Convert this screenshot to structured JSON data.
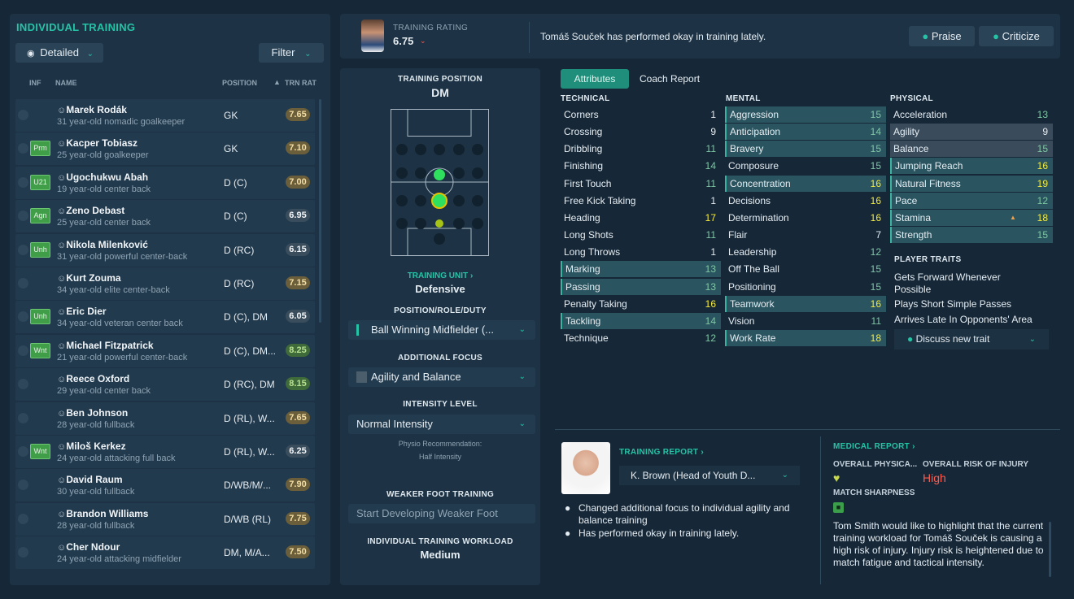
{
  "left": {
    "title": "INDIVIDUAL TRAINING",
    "detailed": "Detailed",
    "filter": "Filter",
    "cols": {
      "inf": "INF",
      "name": "NAME",
      "position": "POSITION",
      "trn": "TRN RAT"
    },
    "players": [
      {
        "name": "Marek Rodák",
        "desc": "31 year-old nomadic goalkeeper",
        "pos": "GK",
        "rat": "7.65",
        "badge": "",
        "ratStyle": "gold"
      },
      {
        "name": "Kacper Tobiasz",
        "desc": "25 year-old goalkeeper",
        "pos": "GK",
        "rat": "7.10",
        "badge": "Prm",
        "ratStyle": "gold"
      },
      {
        "name": "Ugochukwu Abah",
        "desc": "19 year-old center back",
        "pos": "D (C)",
        "rat": "7.00",
        "badge": "U21",
        "ratStyle": "gold"
      },
      {
        "name": "Zeno Debast",
        "desc": "25 year-old center back",
        "pos": "D (C)",
        "rat": "6.95",
        "badge": "Agn",
        "ratStyle": "dark"
      },
      {
        "name": "Nikola Milenković",
        "desc": "31 year-old powerful center-back",
        "pos": "D (RC)",
        "rat": "6.15",
        "badge": "Unh",
        "ratStyle": "dark"
      },
      {
        "name": "Kurt Zouma",
        "desc": "34 year-old elite center-back",
        "pos": "D (RC)",
        "rat": "7.15",
        "badge": "",
        "ratStyle": "gold"
      },
      {
        "name": "Eric Dier",
        "desc": "34 year-old veteran center back",
        "pos": "D (C), DM",
        "rat": "6.05",
        "badge": "Unh",
        "ratStyle": "dark"
      },
      {
        "name": "Michael Fitzpatrick",
        "desc": "21 year-old powerful center-back",
        "pos": "D (C), DM...",
        "rat": "8.25",
        "badge": "Wnt",
        "ratStyle": "green"
      },
      {
        "name": "Reece Oxford",
        "desc": "29 year-old center back",
        "pos": "D (RC), DM",
        "rat": "8.15",
        "badge": "",
        "ratStyle": "green"
      },
      {
        "name": "Ben Johnson",
        "desc": "28 year-old fullback",
        "pos": "D (RL), W...",
        "rat": "7.65",
        "badge": "",
        "ratStyle": "gold"
      },
      {
        "name": "Miloš Kerkez",
        "desc": "24 year-old attacking full back",
        "pos": "D (RL), W...",
        "rat": "6.25",
        "badge": "Wnt",
        "ratStyle": "dark"
      },
      {
        "name": "David Raum",
        "desc": "30 year-old fullback",
        "pos": "D/WB/M/...",
        "rat": "7.90",
        "badge": "",
        "ratStyle": "gold"
      },
      {
        "name": "Brandon Williams",
        "desc": "28 year-old fullback",
        "pos": "D/WB (RL)",
        "rat": "7.75",
        "badge": "",
        "ratStyle": "gold"
      },
      {
        "name": "Cher Ndour",
        "desc": "24 year-old attacking midfielder",
        "pos": "DM, M/A...",
        "rat": "7.50",
        "badge": "",
        "ratStyle": "gold"
      }
    ]
  },
  "top": {
    "label": "TRAINING RATING",
    "rating": "6.75",
    "message": "Tomáš Souček has performed okay in training lately.",
    "praise": "Praise",
    "criticize": "Criticize"
  },
  "mid": {
    "posLabel": "TRAINING POSITION",
    "pos": "DM",
    "unitLabel": "TRAINING UNIT",
    "unit": "Defensive",
    "prdLabel": "POSITION/ROLE/DUTY",
    "prd": "Ball Winning Midfielder (...",
    "focusLabel": "ADDITIONAL FOCUS",
    "focus": "Agility and Balance",
    "intLabel": "INTENSITY LEVEL",
    "intensity": "Normal Intensity",
    "physio1": "Physio Recommendation:",
    "physio2": "Half Intensity",
    "weakLabel": "WEAKER FOOT TRAINING",
    "weak": "Start Developing Weaker Foot",
    "wlLabel": "INDIVIDUAL TRAINING WORKLOAD",
    "workload": "Medium"
  },
  "tabs": {
    "attributes": "Attributes",
    "coach": "Coach Report"
  },
  "technical": {
    "title": "TECHNICAL",
    "items": [
      [
        "Corners",
        "1"
      ],
      [
        "Crossing",
        "9"
      ],
      [
        "Dribbling",
        "11"
      ],
      [
        "Finishing",
        "14"
      ],
      [
        "First Touch",
        "11"
      ],
      [
        "Free Kick Taking",
        "1"
      ],
      [
        "Heading",
        "17"
      ],
      [
        "Long Shots",
        "11"
      ],
      [
        "Long Throws",
        "1"
      ],
      [
        "Marking",
        "13"
      ],
      [
        "Passing",
        "13"
      ],
      [
        "Penalty Taking",
        "16"
      ],
      [
        "Tackling",
        "14"
      ],
      [
        "Technique",
        "12"
      ]
    ]
  },
  "mental": {
    "title": "MENTAL",
    "items": [
      [
        "Aggression",
        "15"
      ],
      [
        "Anticipation",
        "14"
      ],
      [
        "Bravery",
        "15"
      ],
      [
        "Composure",
        "15"
      ],
      [
        "Concentration",
        "16"
      ],
      [
        "Decisions",
        "16"
      ],
      [
        "Determination",
        "16"
      ],
      [
        "Flair",
        "7"
      ],
      [
        "Leadership",
        "12"
      ],
      [
        "Off The Ball",
        "15"
      ],
      [
        "Positioning",
        "15"
      ],
      [
        "Teamwork",
        "16"
      ],
      [
        "Vision",
        "11"
      ],
      [
        "Work Rate",
        "18"
      ]
    ]
  },
  "physical": {
    "title": "PHYSICAL",
    "items": [
      [
        "Acceleration",
        "13"
      ],
      [
        "Agility",
        "9"
      ],
      [
        "Balance",
        "15"
      ],
      [
        "Jumping Reach",
        "16"
      ],
      [
        "Natural Fitness",
        "19"
      ],
      [
        "Pace",
        "12"
      ],
      [
        "Stamina",
        "18"
      ],
      [
        "Strength",
        "15"
      ]
    ]
  },
  "traits": {
    "title": "PLAYER TRAITS",
    "list": [
      "Gets Forward Whenever Possible",
      "Plays Short Simple Passes",
      "Arrives Late In Opponents' Area"
    ],
    "discuss": "Discuss new trait"
  },
  "report": {
    "title": "TRAINING REPORT",
    "coach": "K. Brown (Head of Youth D...",
    "bullets": [
      "Changed additional focus to individual agility and balance training",
      "Has performed okay in training lately."
    ]
  },
  "medical": {
    "title": "MEDICAL REPORT",
    "overall": "OVERALL PHYSICA...",
    "riskLabel": "OVERALL RISK OF INJURY",
    "risk": "High",
    "sharp": "MATCH SHARPNESS",
    "text": "Tom Smith would like to highlight that the current training workload for Tomáš Souček is causing a high risk of injury. Injury risk is heightened due to match fatigue and tactical intensity."
  },
  "colors": {
    "accent": "#26c2a6",
    "warning": "#ff5a4d",
    "yellow": "#f4ea3d"
  }
}
